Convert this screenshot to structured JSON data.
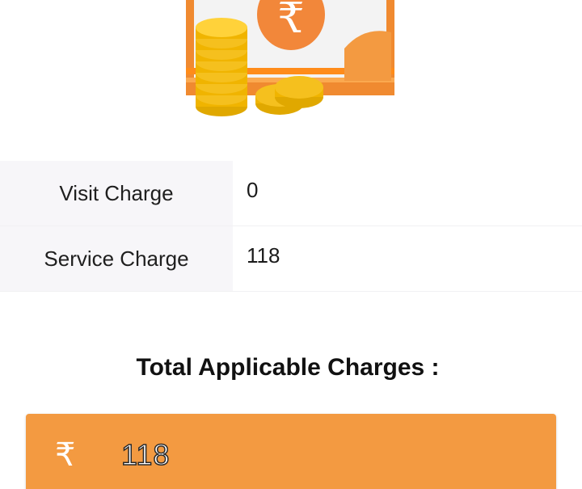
{
  "charges": [
    {
      "label": "Visit Charge",
      "value": "0"
    },
    {
      "label": "Service Charge",
      "value": "118"
    }
  ],
  "total": {
    "heading": "Total Applicable Charges :",
    "currency_symbol": "₹",
    "amount": "118"
  },
  "illustration": {
    "icon": "money-coins-icon",
    "note_symbol": "₹"
  },
  "colors": {
    "accent": "#f39a41",
    "banknote": "#f08a30",
    "coin": "#f5c01e",
    "label_bg": "#f7f6f9"
  }
}
